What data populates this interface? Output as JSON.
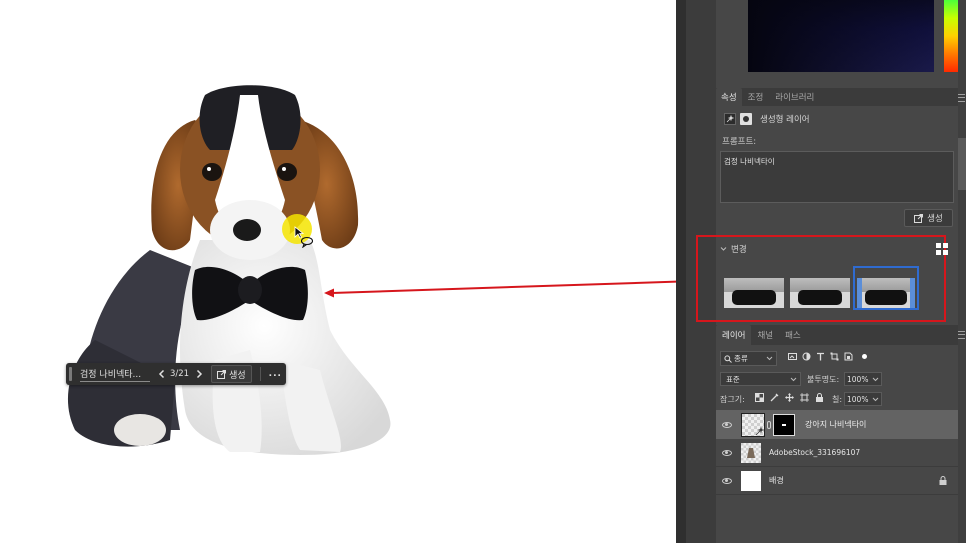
{
  "properties_panel": {
    "tabs": [
      "속성",
      "조정",
      "라이브러리"
    ],
    "layer_type_label": "생성형 레이어",
    "prompt_label": "프롬프트:",
    "prompt_value": "검정 나비넥타이",
    "generate_label": "생성"
  },
  "variations": {
    "section_label": "변경",
    "count": 3
  },
  "layers_panel": {
    "tabs": [
      "레이어",
      "채널",
      "패스"
    ],
    "filter_label": "종류",
    "blend_mode": "표준",
    "opacity_label": "불투명도:",
    "opacity_value": "100%",
    "lock_label": "잠그기:",
    "fill_label": "칠:",
    "fill_value": "100%",
    "layers": [
      {
        "name": "강아지 나비넥타이"
      },
      {
        "name": "AdobeStock_331696107"
      },
      {
        "name": "배경"
      }
    ]
  },
  "contextual_taskbar": {
    "prompt_text": "검정 나비넥타...",
    "pagination": "3/21",
    "generate_label": "생성",
    "more_label": "..."
  },
  "colors": {
    "annotation_red": "#d6161c",
    "selection_blue": "#2f6bd0",
    "cursor_highlight": "#f5e400"
  }
}
